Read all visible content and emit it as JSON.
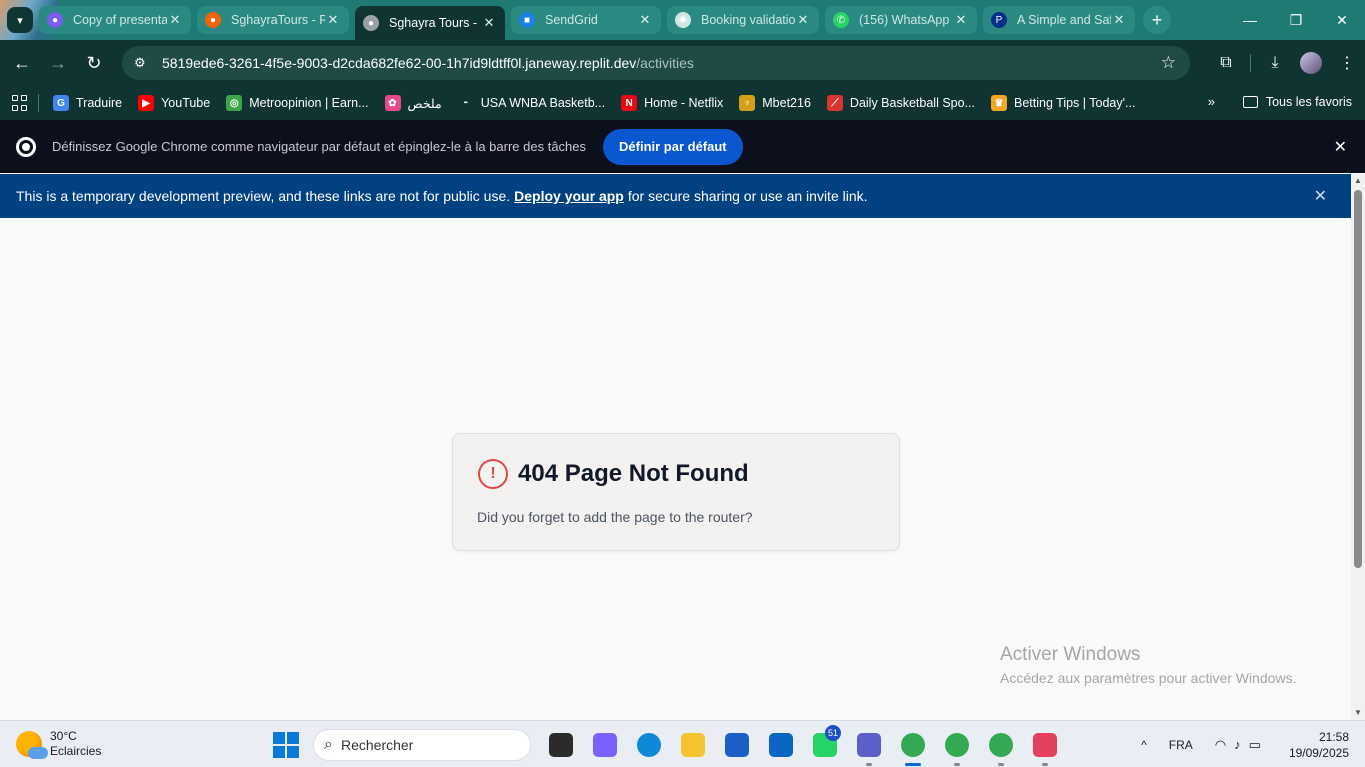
{
  "browser": {
    "tabs": [
      {
        "title": "Copy of presentation",
        "favicon": "canva-icon",
        "color": "#7a5cf0",
        "active": false
      },
      {
        "title": "SghayraTours - Replit",
        "favicon": "replit-icon",
        "color": "#f26207",
        "active": false
      },
      {
        "title": "Sghayra Tours - Replit",
        "favicon": "globe-icon",
        "color": "#9aa0a6",
        "active": true
      },
      {
        "title": "SendGrid",
        "favicon": "sendgrid-icon",
        "color": "#1a82e2",
        "active": false
      },
      {
        "title": "Booking validation",
        "favicon": "openai-icon",
        "color": "#cfe7e4",
        "active": false
      },
      {
        "title": "(156) WhatsApp",
        "favicon": "whatsapp-icon",
        "color": "#25d366",
        "active": false
      },
      {
        "title": "A Simple and Safe",
        "favicon": "paypal-icon",
        "color": "#003087",
        "active": false
      }
    ],
    "url_host": "5819ede6-3261-4f5e-9003-d2cda682fe62-00-1h7id9ldtff0l.janeway.replit.dev",
    "url_path": "/activities",
    "bookmarks": [
      {
        "label": "Traduire",
        "icon": "translate-icon",
        "color": "#4285f4",
        "glyph": "G"
      },
      {
        "label": "YouTube",
        "icon": "youtube-icon",
        "color": "#ff0000",
        "glyph": "▶"
      },
      {
        "label": "Metroopinion | Earn...",
        "icon": "metroopinion-icon",
        "color": "#3aa64a",
        "glyph": "◎"
      },
      {
        "label": "ملخص",
        "icon": "colorful-icon",
        "color": "#e24a8b",
        "glyph": "✿"
      },
      {
        "label": "USA WNBA Basketb...",
        "icon": "flashscore-icon",
        "color": "#0f3431",
        "glyph": "⁃"
      },
      {
        "label": "Home - Netflix",
        "icon": "netflix-icon",
        "color": "#e50914",
        "glyph": "N"
      },
      {
        "label": "Mbet216",
        "icon": "mbet-icon",
        "color": "#d4a017",
        "glyph": "♆"
      },
      {
        "label": "Daily Basketball Spo...",
        "icon": "basketball-icon",
        "color": "#d33",
        "glyph": "⟋"
      },
      {
        "label": "Betting Tips | Today'...",
        "icon": "crown-icon",
        "color": "#f5a623",
        "glyph": "♛"
      }
    ],
    "all_bookmarks": "Tous les favoris",
    "infobar_message": "Définissez Google Chrome comme navigateur par défaut et épinglez-le à la barre des tâches",
    "infobar_button": "Définir par défaut"
  },
  "dev_banner": {
    "text_before": "This is a temporary development preview, and these links are not for public use.",
    "link": "Deploy your app",
    "text_after": "for secure sharing or use an invite link."
  },
  "error_card": {
    "title": "404 Page Not Found",
    "message": "Did you forget to add the page to the router?",
    "icon": "!"
  },
  "watermark": {
    "title": "Activer Windows",
    "subtitle": "Accédez aux paramètres pour activer Windows."
  },
  "taskbar": {
    "temperature": "30°C",
    "weather": "Eclaircies",
    "search_placeholder": "Rechercher",
    "apps": [
      {
        "name": "task-view-icon",
        "color": "#2b2b2b"
      },
      {
        "name": "copilot-icon",
        "color": "#7b61ff"
      },
      {
        "name": "edge-icon",
        "color": "#0c8ad6"
      },
      {
        "name": "file-explorer-icon",
        "color": "#f4c430"
      },
      {
        "name": "store-icon",
        "color": "#1b5fc6"
      },
      {
        "name": "outlook-icon",
        "color": "#0a64c4"
      },
      {
        "name": "whatsapp-icon",
        "color": "#25d366",
        "badge": "51"
      },
      {
        "name": "teams-icon",
        "color": "#5b5fc7"
      },
      {
        "name": "chrome-icon",
        "color": "#34a853",
        "active": true
      },
      {
        "name": "chrome-icon",
        "color": "#34a853"
      },
      {
        "name": "chrome-icon",
        "color": "#34a853"
      },
      {
        "name": "snipping-tool-icon",
        "color": "#e4405f"
      }
    ],
    "language": "FRA",
    "time": "21:58",
    "date": "19/09/2025"
  }
}
